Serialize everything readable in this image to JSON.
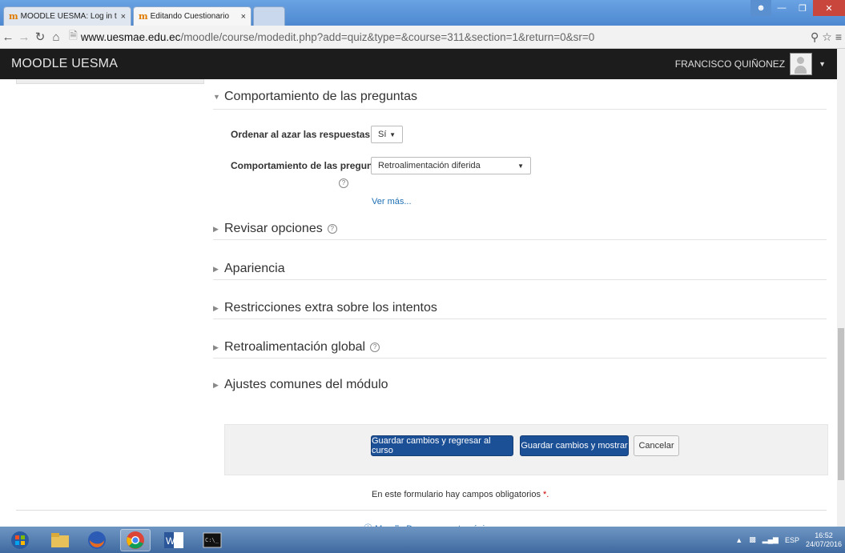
{
  "browser": {
    "tabs": [
      {
        "label": "MOODLE UESMA: Log in t",
        "close": "×"
      },
      {
        "label": "Editando Cuestionario",
        "close": "×"
      }
    ],
    "url_domain": "www.uesmae.edu.ec",
    "url_path": "/moodle/course/modedit.php?add=quiz&type=&course=311&section=1&return=0&sr=0"
  },
  "header": {
    "brand": "MOODLE UESMA",
    "user_name": "FRANCISCO QUIÑONEZ"
  },
  "form": {
    "behaviour_section_title": "Comportamiento de las preguntas",
    "shuffle_label": "Ordenar al azar las respuestas",
    "shuffle_value": "Sí",
    "behaviour_label": "Comportamiento de las preguntas",
    "behaviour_value": "Retroalimentación diferida",
    "more_link": "Ver más...",
    "collapsed_sections": [
      "Revisar opciones",
      "Apariencia",
      "Restricciones extra sobre los intentos",
      "Retroalimentación global",
      "Ajustes comunes del módulo"
    ],
    "buttons": {
      "save_return": "Guardar cambios y regresar al curso",
      "save_display": "Guardar cambios y mostrar",
      "cancel": "Cancelar"
    },
    "required_note": "En este formulario hay campos obligatorios",
    "required_star": "*."
  },
  "footer": {
    "docs_link": "Moodle Docs para esta página"
  },
  "taskbar": {
    "language": "ESP",
    "time": "16:52",
    "date": "24/07/2016"
  }
}
